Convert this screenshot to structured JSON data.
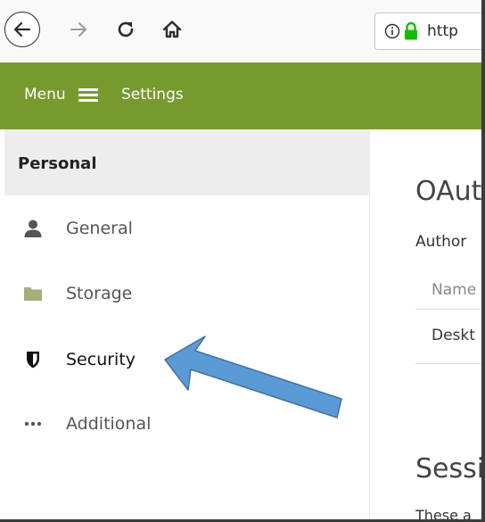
{
  "browser": {
    "url_partial": "http",
    "icons": {
      "back": "back-arrow-icon",
      "forward": "forward-arrow-icon",
      "reload": "reload-icon",
      "home": "home-icon",
      "info": "info-icon",
      "lock": "padlock-icon"
    }
  },
  "header": {
    "menu_label": "Menu",
    "menu_icon": "hamburger-icon",
    "settings_label": "Settings",
    "accent_color": "#769a2d"
  },
  "sidebar": {
    "heading": "Personal",
    "items": [
      {
        "label": "General",
        "icon": "person-icon",
        "active": false
      },
      {
        "label": "Storage",
        "icon": "folder-icon",
        "active": false
      },
      {
        "label": "Security",
        "icon": "shield-icon",
        "active": true
      },
      {
        "label": "Additional",
        "icon": "more-dots-icon",
        "active": false
      }
    ]
  },
  "main": {
    "oauth_title": "OAut",
    "auth_text": "Author",
    "column_name": "Name",
    "row_value": "Deskt",
    "sessions_title": "Sessi",
    "sessions_text": "These a"
  },
  "annotation": {
    "arrow_color": "#5b9bd5",
    "arrow_outline": "#41719c",
    "points_to": "Security"
  }
}
